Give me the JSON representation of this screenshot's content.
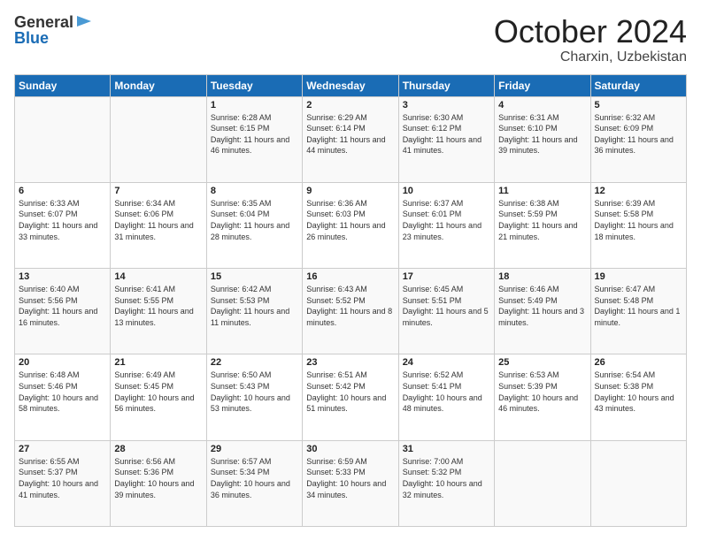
{
  "header": {
    "logo_general": "General",
    "logo_blue": "Blue",
    "month": "October 2024",
    "location": "Charxin, Uzbekistan"
  },
  "days_of_week": [
    "Sunday",
    "Monday",
    "Tuesday",
    "Wednesday",
    "Thursday",
    "Friday",
    "Saturday"
  ],
  "weeks": [
    [
      {
        "day": "",
        "info": ""
      },
      {
        "day": "",
        "info": ""
      },
      {
        "day": "1",
        "info": "Sunrise: 6:28 AM\nSunset: 6:15 PM\nDaylight: 11 hours and 46 minutes."
      },
      {
        "day": "2",
        "info": "Sunrise: 6:29 AM\nSunset: 6:14 PM\nDaylight: 11 hours and 44 minutes."
      },
      {
        "day": "3",
        "info": "Sunrise: 6:30 AM\nSunset: 6:12 PM\nDaylight: 11 hours and 41 minutes."
      },
      {
        "day": "4",
        "info": "Sunrise: 6:31 AM\nSunset: 6:10 PM\nDaylight: 11 hours and 39 minutes."
      },
      {
        "day": "5",
        "info": "Sunrise: 6:32 AM\nSunset: 6:09 PM\nDaylight: 11 hours and 36 minutes."
      }
    ],
    [
      {
        "day": "6",
        "info": "Sunrise: 6:33 AM\nSunset: 6:07 PM\nDaylight: 11 hours and 33 minutes."
      },
      {
        "day": "7",
        "info": "Sunrise: 6:34 AM\nSunset: 6:06 PM\nDaylight: 11 hours and 31 minutes."
      },
      {
        "day": "8",
        "info": "Sunrise: 6:35 AM\nSunset: 6:04 PM\nDaylight: 11 hours and 28 minutes."
      },
      {
        "day": "9",
        "info": "Sunrise: 6:36 AM\nSunset: 6:03 PM\nDaylight: 11 hours and 26 minutes."
      },
      {
        "day": "10",
        "info": "Sunrise: 6:37 AM\nSunset: 6:01 PM\nDaylight: 11 hours and 23 minutes."
      },
      {
        "day": "11",
        "info": "Sunrise: 6:38 AM\nSunset: 5:59 PM\nDaylight: 11 hours and 21 minutes."
      },
      {
        "day": "12",
        "info": "Sunrise: 6:39 AM\nSunset: 5:58 PM\nDaylight: 11 hours and 18 minutes."
      }
    ],
    [
      {
        "day": "13",
        "info": "Sunrise: 6:40 AM\nSunset: 5:56 PM\nDaylight: 11 hours and 16 minutes."
      },
      {
        "day": "14",
        "info": "Sunrise: 6:41 AM\nSunset: 5:55 PM\nDaylight: 11 hours and 13 minutes."
      },
      {
        "day": "15",
        "info": "Sunrise: 6:42 AM\nSunset: 5:53 PM\nDaylight: 11 hours and 11 minutes."
      },
      {
        "day": "16",
        "info": "Sunrise: 6:43 AM\nSunset: 5:52 PM\nDaylight: 11 hours and 8 minutes."
      },
      {
        "day": "17",
        "info": "Sunrise: 6:45 AM\nSunset: 5:51 PM\nDaylight: 11 hours and 5 minutes."
      },
      {
        "day": "18",
        "info": "Sunrise: 6:46 AM\nSunset: 5:49 PM\nDaylight: 11 hours and 3 minutes."
      },
      {
        "day": "19",
        "info": "Sunrise: 6:47 AM\nSunset: 5:48 PM\nDaylight: 11 hours and 1 minute."
      }
    ],
    [
      {
        "day": "20",
        "info": "Sunrise: 6:48 AM\nSunset: 5:46 PM\nDaylight: 10 hours and 58 minutes."
      },
      {
        "day": "21",
        "info": "Sunrise: 6:49 AM\nSunset: 5:45 PM\nDaylight: 10 hours and 56 minutes."
      },
      {
        "day": "22",
        "info": "Sunrise: 6:50 AM\nSunset: 5:43 PM\nDaylight: 10 hours and 53 minutes."
      },
      {
        "day": "23",
        "info": "Sunrise: 6:51 AM\nSunset: 5:42 PM\nDaylight: 10 hours and 51 minutes."
      },
      {
        "day": "24",
        "info": "Sunrise: 6:52 AM\nSunset: 5:41 PM\nDaylight: 10 hours and 48 minutes."
      },
      {
        "day": "25",
        "info": "Sunrise: 6:53 AM\nSunset: 5:39 PM\nDaylight: 10 hours and 46 minutes."
      },
      {
        "day": "26",
        "info": "Sunrise: 6:54 AM\nSunset: 5:38 PM\nDaylight: 10 hours and 43 minutes."
      }
    ],
    [
      {
        "day": "27",
        "info": "Sunrise: 6:55 AM\nSunset: 5:37 PM\nDaylight: 10 hours and 41 minutes."
      },
      {
        "day": "28",
        "info": "Sunrise: 6:56 AM\nSunset: 5:36 PM\nDaylight: 10 hours and 39 minutes."
      },
      {
        "day": "29",
        "info": "Sunrise: 6:57 AM\nSunset: 5:34 PM\nDaylight: 10 hours and 36 minutes."
      },
      {
        "day": "30",
        "info": "Sunrise: 6:59 AM\nSunset: 5:33 PM\nDaylight: 10 hours and 34 minutes."
      },
      {
        "day": "31",
        "info": "Sunrise: 7:00 AM\nSunset: 5:32 PM\nDaylight: 10 hours and 32 minutes."
      },
      {
        "day": "",
        "info": ""
      },
      {
        "day": "",
        "info": ""
      }
    ]
  ]
}
